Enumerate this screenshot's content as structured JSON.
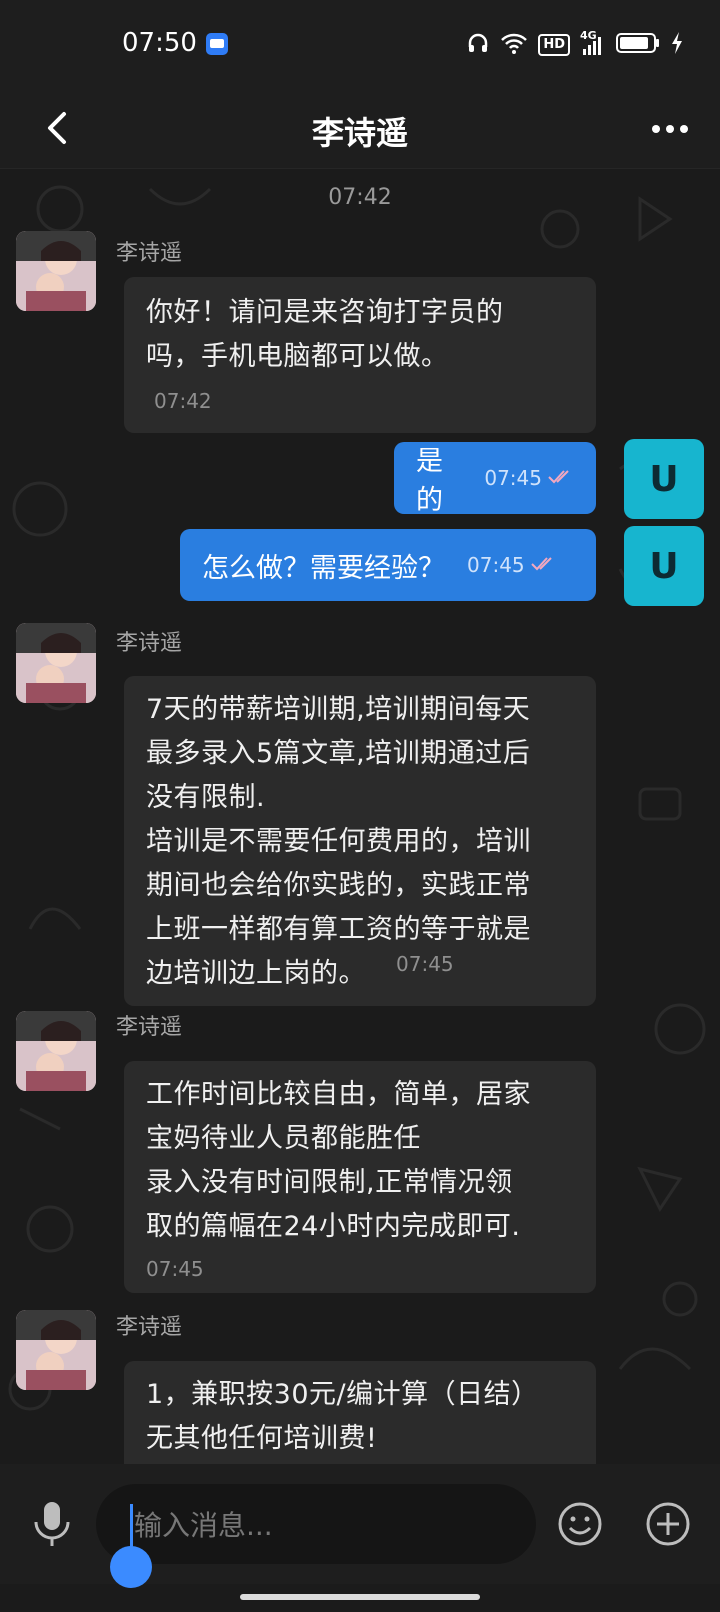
{
  "status_bar": {
    "time": "07:50",
    "icons": [
      "message-app-icon",
      "headphones-icon",
      "wifi-icon",
      "hd-icon",
      "signal-4g-icon",
      "battery-icon",
      "charging-icon"
    ],
    "hd_label": "HD",
    "network_label": "4G"
  },
  "header": {
    "title": "李诗遥",
    "back_icon": "back-arrow-icon",
    "more_icon": "more-dots-icon"
  },
  "chat": {
    "time_separator": "07:42",
    "messages": [
      {
        "direction": "incoming",
        "sender": "李诗遥",
        "text": "你好！请问是来咨询打字员的\n吗，手机电脑都可以做。",
        "time": "07:42"
      },
      {
        "direction": "outgoing",
        "avatar_letter": "U",
        "text": "是的",
        "time": "07:45",
        "status": "read-check-icon"
      },
      {
        "direction": "outgoing",
        "avatar_letter": "U",
        "text": "怎么做？需要经验？",
        "time": "07:45",
        "status": "read-check-icon"
      },
      {
        "direction": "incoming",
        "sender": "李诗遥",
        "text": "7天的带薪培训期,培训期间每天\n最多录入5篇文章,培训期通过后\n没有限制.\n培训是不需要任何费用的，培训\n期间也会给你实践的，实践正常\n上班一样都有算工资的等于就是\n边培训边上岗的。",
        "time": "07:45"
      },
      {
        "direction": "incoming",
        "sender": "李诗遥",
        "text": "工作时间比较自由，简单，居家\n宝妈待业人员都能胜任\n录入没有时间限制,正常情况领\n取的篇幅在24小时内完成即可.",
        "time": "07:45"
      },
      {
        "direction": "incoming",
        "sender": "李诗遥",
        "text": "1，兼职按30元/编计算（日结）\n无其他任何培训费!",
        "time": ""
      }
    ]
  },
  "input_bar": {
    "placeholder": "输入消息...",
    "mic_icon": "microphone-icon",
    "emoji_icon": "emoji-icon",
    "plus_icon": "plus-icon"
  },
  "colors": {
    "background": "#1b1b1b",
    "incoming_bubble": "#2b2b2b",
    "outgoing_bubble": "#2a7ee0",
    "user_avatar": "#17b5cf",
    "cursor": "#3b8bff"
  }
}
